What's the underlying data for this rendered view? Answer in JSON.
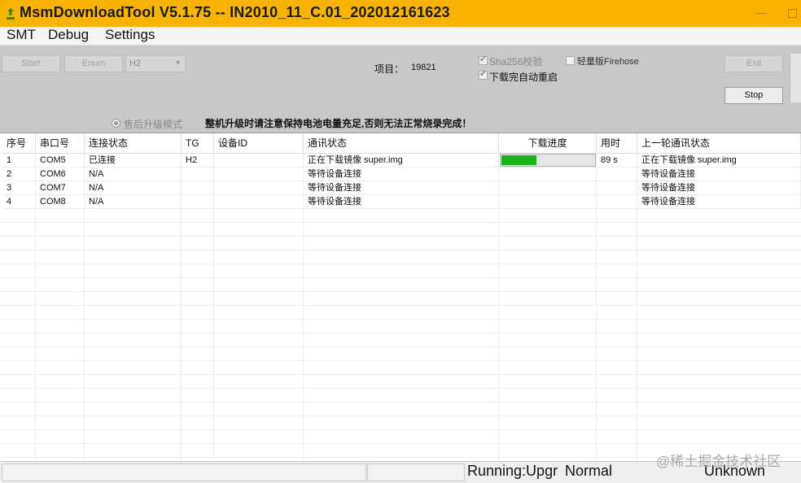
{
  "window": {
    "title": "MsmDownloadTool V5.1.75 -- IN2010_11_C.01_202012161623"
  },
  "menu": {
    "items": [
      "SMT",
      "Debug",
      "Settings"
    ]
  },
  "toolbar": {
    "start_label": "Start",
    "enum_label": "Enum",
    "target_select": "H2",
    "exit_label": "Exit",
    "stop_label": "Stop",
    "project_label": "项目：",
    "project_value": "19821",
    "sha256_label": "Sha256校验",
    "sha256_checked": true,
    "reboot_label": "下载完自动重启",
    "reboot_checked": true,
    "lite_firehose_label": "轻量版Firehose",
    "lite_firehose_checked": false,
    "after_sales_label": "售后升级模式",
    "notice": "整机升级时请注意保持电池电量充足,否则无法正常烧录完成！"
  },
  "table": {
    "headers": [
      "序号",
      "串口号",
      "连接状态",
      "TG",
      "设备ID",
      "通讯状态",
      "下载进度",
      "用时",
      "上一轮通讯状态"
    ],
    "rows": [
      {
        "no": "1",
        "port": "COM5",
        "conn": "已连接",
        "tg": "H2",
        "device_id": "",
        "comm": "正在下载镜像 super.img",
        "progress": 0.38,
        "time": "89 s",
        "last": "正在下载镜像 super.img"
      },
      {
        "no": "2",
        "port": "COM6",
        "conn": "N/A",
        "tg": "",
        "device_id": "",
        "comm": "等待设备连接",
        "progress": null,
        "time": "",
        "last": "等待设备连接"
      },
      {
        "no": "3",
        "port": "COM7",
        "conn": "N/A",
        "tg": "",
        "device_id": "",
        "comm": "等待设备连接",
        "progress": null,
        "time": "",
        "last": "等待设备连接"
      },
      {
        "no": "4",
        "port": "COM8",
        "conn": "N/A",
        "tg": "",
        "device_id": "",
        "comm": "等待设备连接",
        "progress": null,
        "time": "",
        "last": "等待设备连接"
      }
    ]
  },
  "statusbar": {
    "running": "Running:Upgr",
    "mode": "Normal",
    "status": "Unknown"
  },
  "watermark": "@稀土掘金技术社区",
  "colors": {
    "titlebar": "#f8b400",
    "progress_fill": "#1bb21b"
  }
}
